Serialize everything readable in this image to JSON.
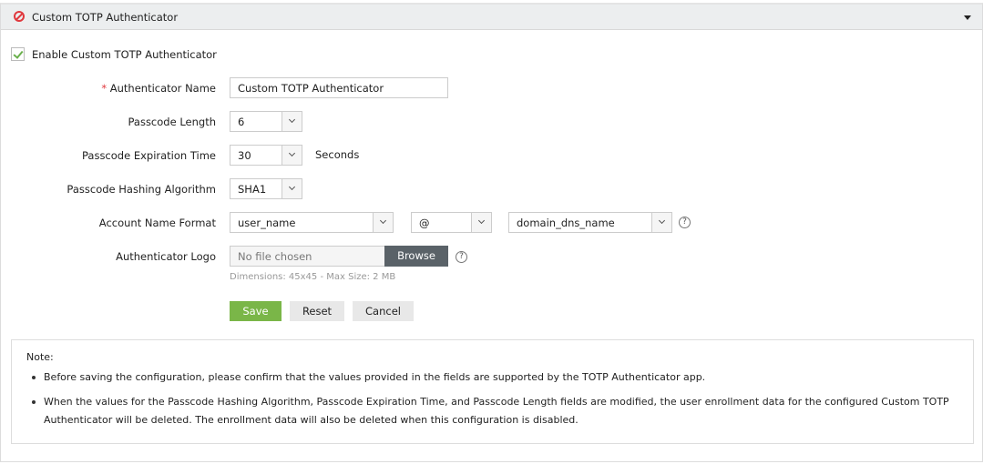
{
  "header": {
    "title": "Custom TOTP Authenticator"
  },
  "enable": {
    "label": "Enable Custom TOTP Authenticator",
    "checked": true
  },
  "form": {
    "name": {
      "required_mark": "*",
      "label": "Authenticator Name",
      "value": "Custom TOTP Authenticator"
    },
    "length": {
      "label": "Passcode Length",
      "value": "6"
    },
    "expiration": {
      "label": "Passcode Expiration Time",
      "value": "30",
      "unit": "Seconds"
    },
    "hashing": {
      "label": "Passcode Hashing Algorithm",
      "value": "SHA1"
    },
    "account": {
      "label": "Account Name Format",
      "user": "user_name",
      "separator": "@",
      "domain": "domain_dns_name",
      "help": "?"
    },
    "logo": {
      "label": "Authenticator Logo",
      "placeholder": "No file chosen",
      "browse": "Browse",
      "help": "?",
      "hint": "Dimensions: 45x45 - Max Size: 2 MB"
    }
  },
  "buttons": {
    "save": "Save",
    "reset": "Reset",
    "cancel": "Cancel"
  },
  "colors": {
    "save": "#7ab648",
    "browse": "#5a6268"
  },
  "note": {
    "title": "Note:",
    "items": [
      "Before saving the configuration, please confirm that the values provided in the fields are supported by the TOTP Authenticator app.",
      "When the values for the Passcode Hashing Algorithm, Passcode Expiration Time, and Passcode Length fields are modified, the user enrollment data for the configured Custom TOTP Authenticator will be deleted. The enrollment data will also be deleted when this configuration is disabled."
    ]
  }
}
